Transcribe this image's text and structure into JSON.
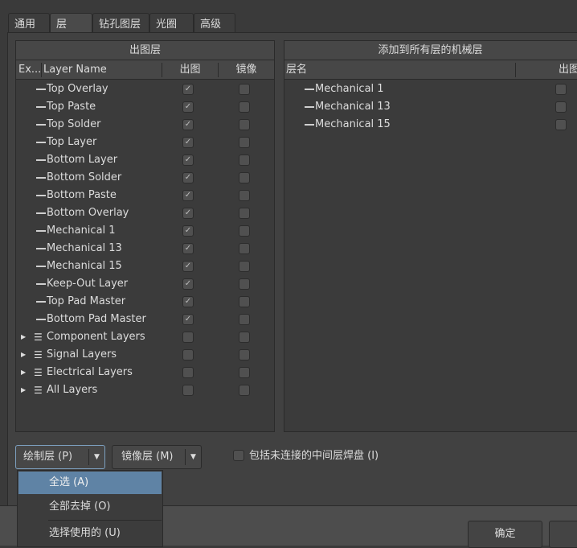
{
  "tabs": [
    "通用",
    "层",
    "钻孔图层",
    "光圈",
    "高级"
  ],
  "active_tab": 1,
  "left_table": {
    "title": "出图层",
    "columns": [
      "Ex...",
      "Layer Name",
      "出图",
      "镜像"
    ],
    "rows": [
      {
        "name": "Top Overlay",
        "plot": true,
        "mirror": false,
        "group": false
      },
      {
        "name": "Top Paste",
        "plot": true,
        "mirror": false,
        "group": false
      },
      {
        "name": "Top Solder",
        "plot": true,
        "mirror": false,
        "group": false
      },
      {
        "name": "Top Layer",
        "plot": true,
        "mirror": false,
        "group": false
      },
      {
        "name": "Bottom Layer",
        "plot": true,
        "mirror": false,
        "group": false
      },
      {
        "name": "Bottom Solder",
        "plot": true,
        "mirror": false,
        "group": false
      },
      {
        "name": "Bottom Paste",
        "plot": true,
        "mirror": false,
        "group": false
      },
      {
        "name": "Bottom Overlay",
        "plot": true,
        "mirror": false,
        "group": false
      },
      {
        "name": "Mechanical 1",
        "plot": true,
        "mirror": false,
        "group": false
      },
      {
        "name": "Mechanical 13",
        "plot": true,
        "mirror": false,
        "group": false
      },
      {
        "name": "Mechanical 15",
        "plot": true,
        "mirror": false,
        "group": false
      },
      {
        "name": "Keep-Out Layer",
        "plot": true,
        "mirror": false,
        "group": false
      },
      {
        "name": "Top Pad Master",
        "plot": true,
        "mirror": false,
        "group": false
      },
      {
        "name": "Bottom Pad Master",
        "plot": true,
        "mirror": false,
        "group": false
      },
      {
        "name": "Component Layers",
        "plot": false,
        "mirror": false,
        "group": true
      },
      {
        "name": "Signal Layers",
        "plot": false,
        "mirror": false,
        "group": true
      },
      {
        "name": "Electrical Layers",
        "plot": false,
        "mirror": false,
        "group": true
      },
      {
        "name": "All Layers",
        "plot": false,
        "mirror": false,
        "group": true
      }
    ]
  },
  "right_table": {
    "title": "添加到所有层的机械层",
    "columns": [
      "层名",
      "出图"
    ],
    "rows": [
      {
        "name": "Mechanical 1",
        "plot": false
      },
      {
        "name": "Mechanical 13",
        "plot": false
      },
      {
        "name": "Mechanical 15",
        "plot": false
      }
    ]
  },
  "buttons": {
    "plot_layers": "绘制层 (P)",
    "mirror_layers": "镜像层 (M)",
    "ok": "确定"
  },
  "checkbox_label": "包括未连接的中间层焊盘 (I)",
  "dropdown_menu": {
    "items": [
      "全选 (A)",
      "全部去掉 (O)",
      "选择使用的 (U)"
    ],
    "highlighted": 0
  },
  "colors": {
    "highlight": "#5f83a5",
    "background": "#414141"
  }
}
